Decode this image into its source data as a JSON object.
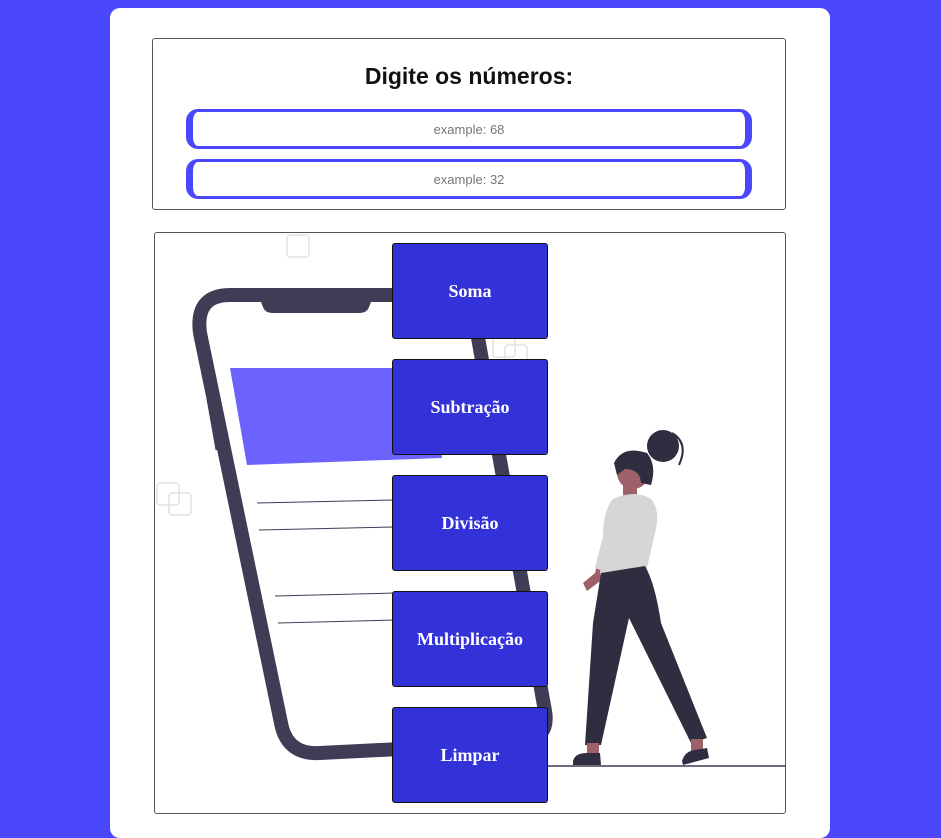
{
  "header": {
    "title": "Digite os números:"
  },
  "inputs": [
    {
      "placeholder": "example: 68",
      "value": ""
    },
    {
      "placeholder": "example: 32",
      "value": ""
    }
  ],
  "operations": [
    {
      "label": "Soma"
    },
    {
      "label": "Subtração"
    },
    {
      "label": "Divisão"
    },
    {
      "label": "Multiplicação"
    },
    {
      "label": "Limpar"
    }
  ],
  "colors": {
    "background": "#4a47fd",
    "button": "#3331d8",
    "phone": "#3f3d56",
    "screen_accent": "#6c63ff"
  }
}
